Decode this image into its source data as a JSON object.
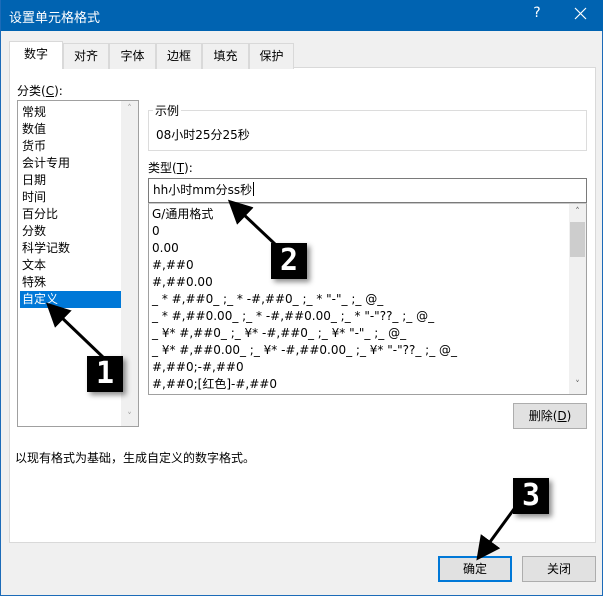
{
  "window": {
    "title": "设置单元格格式",
    "help_label": "?",
    "close_icon": "close-icon"
  },
  "tabs": [
    {
      "label": "数字",
      "active": true
    },
    {
      "label": "对齐",
      "active": false
    },
    {
      "label": "字体",
      "active": false
    },
    {
      "label": "边框",
      "active": false
    },
    {
      "label": "填充",
      "active": false
    },
    {
      "label": "保护",
      "active": false
    }
  ],
  "category": {
    "label_prefix": "分类(",
    "label_key": "C",
    "label_suffix": "):",
    "items": [
      "常规",
      "数值",
      "货币",
      "会计专用",
      "日期",
      "时间",
      "百分比",
      "分数",
      "科学记数",
      "文本",
      "特殊",
      "自定义"
    ],
    "selected": "自定义"
  },
  "sample": {
    "legend": "示例",
    "value": "08小时25分25秒"
  },
  "type": {
    "label_prefix": "类型(",
    "label_key": "T",
    "label_suffix": "):",
    "input_value": "hh小时mm分ss秒",
    "formats": [
      "G/通用格式",
      "0",
      "0.00",
      "#,##0",
      "#,##0.00",
      "_ * #,##0_ ;_ * -#,##0_ ;_ * \"-\"_ ;_ @_",
      "_ * #,##0.00_ ;_ * -#,##0.00_ ;_ * \"-\"??_ ;_ @_",
      "_ ¥* #,##0_ ;_ ¥* -#,##0_ ;_ ¥* \"-\"_ ;_ @_",
      "_ ¥* #,##0.00_ ;_ ¥* -#,##0.00_ ;_ ¥* \"-\"??_ ;_ @_",
      "#,##0;-#,##0",
      "#,##0;[红色]-#,##0"
    ]
  },
  "buttons": {
    "delete_prefix": "删除(",
    "delete_key": "D",
    "delete_suffix": ")",
    "ok": "确定",
    "close": "关闭"
  },
  "description": "以现有格式为基础，生成自定义的数字格式。",
  "callouts": [
    "1",
    "2",
    "3"
  ],
  "colors": {
    "titlebar": "#0063b1",
    "selection": "#0078d7",
    "default_button_border": "#0078d7"
  }
}
